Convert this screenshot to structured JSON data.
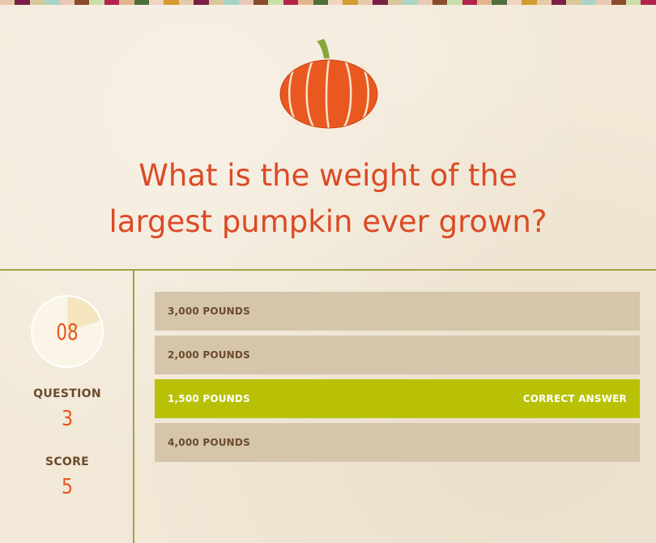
{
  "question": {
    "line1": "What is the weight of the",
    "line2": "largest pumpkin ever grown?"
  },
  "timer": {
    "value": "08",
    "remaining_fraction": 0.8
  },
  "stats": {
    "question_label": "QUESTION",
    "question_number": "3",
    "score_label": "SCORE",
    "score_value": "5"
  },
  "answers": [
    {
      "label": "3,000 POUNDS",
      "status": "",
      "correct": false
    },
    {
      "label": "2,000 POUNDS",
      "status": "",
      "correct": false
    },
    {
      "label": "1,500 POUNDS",
      "status": "CORRECT ANSWER",
      "correct": true
    },
    {
      "label": "4,000 POUNDS",
      "status": "",
      "correct": false
    }
  ],
  "colors": {
    "accent": "#dc4a25",
    "correct": "#b9c107",
    "answer_bg": "#d5c6ab",
    "divider": "#a0a247",
    "stripe": [
      "#e6c9a8",
      "#7a2046",
      "#d9c79c",
      "#a8d4c6",
      "#e8c9b5",
      "#8a4c2c",
      "#c9dfa8",
      "#b5224c",
      "#e2b58f",
      "#4d6f3b",
      "#f0d3c1",
      "#d49b2e"
    ]
  },
  "icons": {
    "header_image": "pumpkin-icon"
  }
}
